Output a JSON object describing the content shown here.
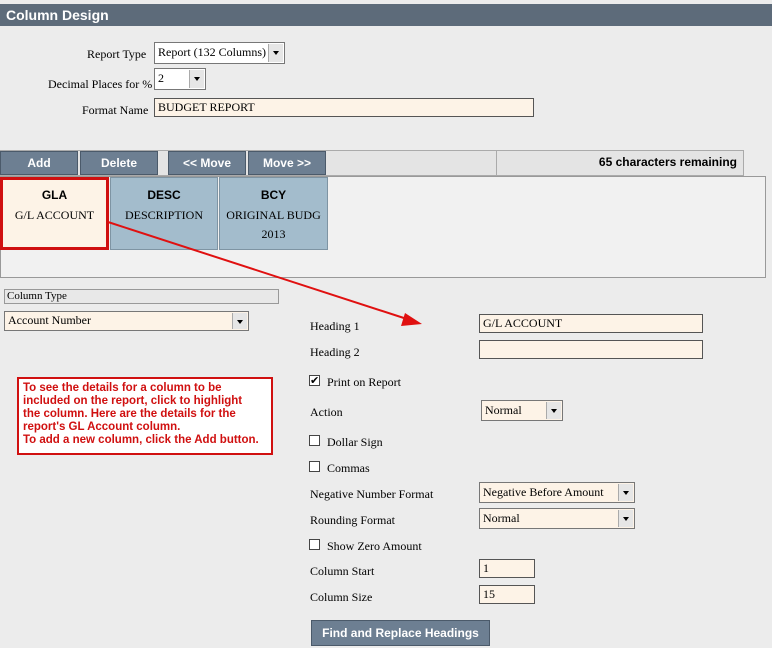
{
  "window": {
    "title": "Column Design"
  },
  "form": {
    "report_type_label": "Report Type",
    "report_type_value": "Report (132 Columns)",
    "decimal_label": "Decimal Places for %",
    "decimal_value": "2",
    "format_name_label": "Format Name",
    "format_name_value": "BUDGET REPORT"
  },
  "toolbar": {
    "add": "Add",
    "delete": "Delete",
    "move_left": "<< Move",
    "move_right": "Move >>",
    "remaining": "65 characters remaining"
  },
  "columns": [
    {
      "code": "GLA",
      "line1": "G/L ACCOUNT",
      "line2": ""
    },
    {
      "code": "DESC",
      "line1": "DESCRIPTION",
      "line2": ""
    },
    {
      "code": "BCY",
      "line1": "ORIGINAL BUDG",
      "line2": "2013"
    }
  ],
  "column_type": {
    "label": "Column Type",
    "value": "Account Number"
  },
  "details": {
    "heading1_label": "Heading 1",
    "heading1_value": "G/L ACCOUNT",
    "heading2_label": "Heading 2",
    "heading2_value": "",
    "print_label": "Print on Report",
    "print_checked": "✔",
    "action_label": "Action",
    "action_value": "Normal",
    "dollar_label": "Dollar Sign",
    "commas_label": "Commas",
    "negative_label": "Negative Number Format",
    "negative_value": "Negative Before Amount",
    "rounding_label": "Rounding Format",
    "rounding_value": "Normal",
    "zero_label": "Show Zero Amount",
    "col_start_label": "Column Start",
    "col_start_value": "1",
    "col_size_label": "Column Size",
    "col_size_value": "15",
    "find_replace": "Find and Replace Headings"
  },
  "note": {
    "lines": [
      "To see the details for a column to be",
      "included on the report, click to highlight",
      "the column.  Here are the details for the",
      "report's GL Account column.",
      "To add a new column, click the Add button."
    ]
  },
  "colors": {
    "accent": "#d01010",
    "titlebar": "#5d6b7a",
    "button": "#6d7f92"
  }
}
